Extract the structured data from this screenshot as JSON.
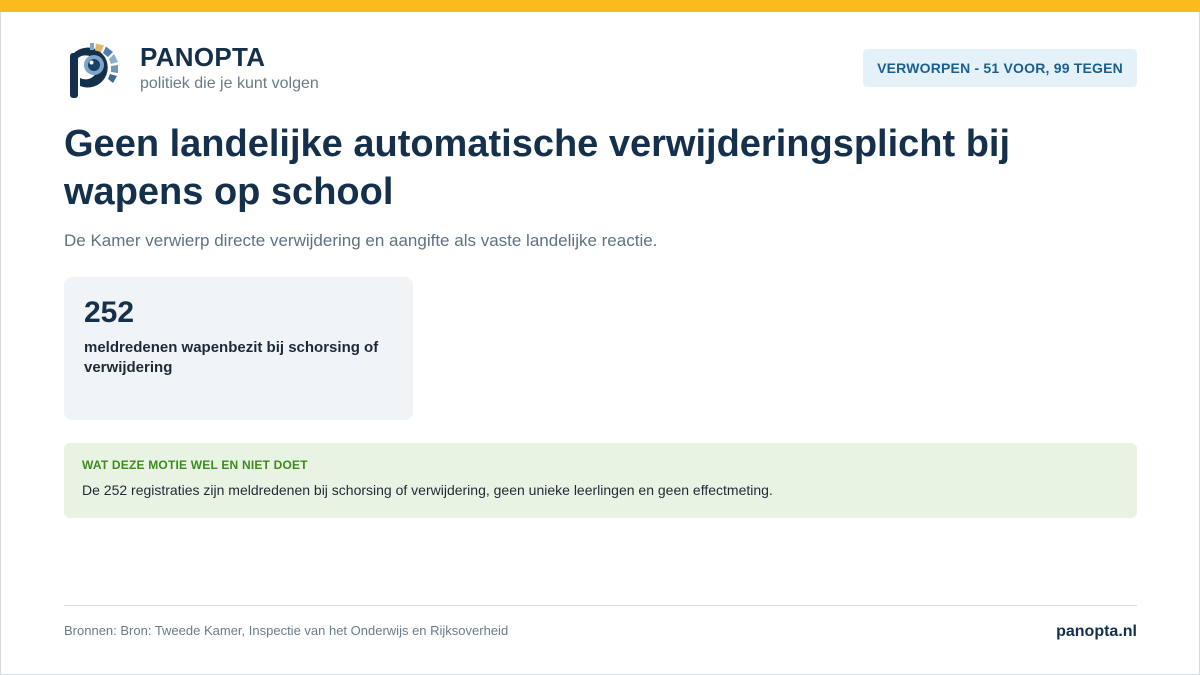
{
  "brand": {
    "name": "PANOPTA",
    "tagline": "politiek die je kunt volgen",
    "logo_icon": "eye-p-logo-icon"
  },
  "status": {
    "label": "VERWORPEN - 51 VOOR, 99 TEGEN",
    "votes_for": 51,
    "votes_against": 99
  },
  "main": {
    "title": "Geen landelijke automatische verwijderingsplicht bij wapens op school",
    "subtitle": "De Kamer verwierp directe verwijdering en aangifte als vaste landelijke reactie."
  },
  "stat": {
    "value": "252",
    "label": "meldredenen wapenbezit bij schorsing of verwijdering"
  },
  "note": {
    "heading": "WAT DEZE MOTIE WEL EN NIET DOET",
    "text": "De 252 registraties zijn meldredenen bij schorsing of verwijdering, geen unieke leerlingen en geen effectmeting."
  },
  "footer": {
    "sources": "Bronnen: Bron: Tweede Kamer, Inspectie van het Onderwijs en Rijksoverheid",
    "site": "panopta.nl"
  },
  "colors": {
    "accent_bar": "#fbbb1f",
    "navy": "#14304a",
    "badge_bg": "#e4f1f9",
    "badge_text": "#1a5f8f",
    "note_bg": "#e9f3e4",
    "note_heading": "#3f8a1e"
  }
}
